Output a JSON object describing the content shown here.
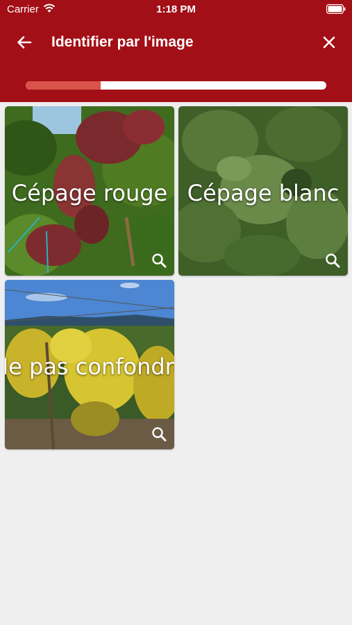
{
  "status_bar": {
    "carrier": "Carrier",
    "time": "1:18 PM"
  },
  "toolbar": {
    "title": "Identifier par l'image"
  },
  "progress": {
    "value": 0.25
  },
  "cards": [
    {
      "label": "Cépage rouge",
      "icon": "search-zoom-icon"
    },
    {
      "label": "Cépage blanc",
      "icon": "search-zoom-icon"
    },
    {
      "label": "Ne pas confondre",
      "icon": "search-zoom-icon"
    }
  ],
  "colors": {
    "header": "#a30f16",
    "progress_fill": "#d9534a",
    "background": "#efefef"
  }
}
